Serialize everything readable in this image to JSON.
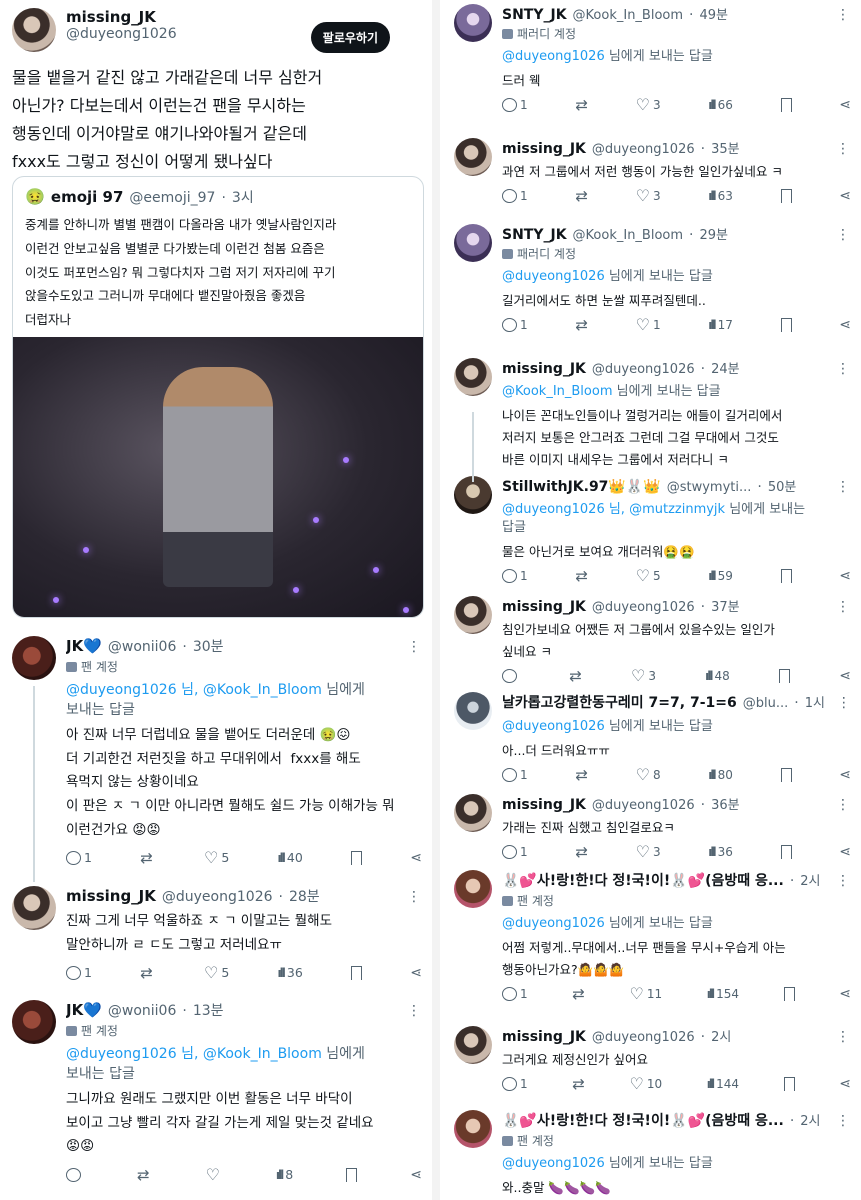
{
  "left": {
    "main_post": {
      "name": "missing_JK",
      "handle": "@duyeong1026",
      "follow_label": "팔로우하기",
      "text": "물을 뱉을거 같진 않고 가래같은데 너무 심한거\n아닌가? 다보는데서 이런는건 팬을 무시하는\n행동인데 이거야말로 얘기나와야될거 같은데\nfxxx도 그렇고 정신이 어떻게 됐나싶다"
    },
    "quote": {
      "emoji": "🤢",
      "name": "emoji 97",
      "handle": "@eemoji_97",
      "time": "3시",
      "text": "중계를 안하니까 별별 팬캠이 다올라옴 내가 옛날사람인지라\n이런건 안보고싶음 별별쿤 다가봤는데 이런건 첨봄 요즘은\n이것도 퍼포먼스임? 뭐 그렇다치자 그럼 저기 저자리에 꾸기\n앉을수도있고 그러니까 무대에다 뱉진말아줬음 좋겠음\n더럽자나"
    },
    "replies": [
      {
        "name": "JK💙",
        "handle": "@wonii06",
        "time": "30분",
        "badge": "팬 계정",
        "replyto_prefix": "",
        "replyto_links": "@duyeong1026 님, @Kook_In_Bloom",
        "replyto_suffix": " 님에게\n보내는 답글",
        "text": "아 진짜 너무 더럽네요 물을 뱉어도 더러운데 🤢😖\n더 기괴한건 저런짓을 하고 무대위에서  fxxx를 해도\n욕먹지 않는 상황이네요\n이 판은 ㅈ ㄱ 이만 아니라면 뭘해도 쉴드 가능 이해가능 뭐\n이런건가요 😡😡",
        "reply_count": "1",
        "retweet_count": "",
        "like_count": "5",
        "view_count": "40"
      },
      {
        "name": "missing_JK",
        "handle": "@duyeong1026",
        "time": "28분",
        "text": "진짜 그게 너무 억울하죠 ㅈ ㄱ 이말고는 뭘해도\n말안하니까 ㄹ ㄷ도 그렇고 저러네요ㅠ",
        "reply_count": "1",
        "retweet_count": "",
        "like_count": "5",
        "view_count": "36"
      },
      {
        "name": "JK💙",
        "handle": "@wonii06",
        "time": "13분",
        "badge": "팬 계정",
        "replyto_links": "@duyeong1026 님, @Kook_In_Bloom",
        "replyto_suffix": " 님에게\n보내는 답글",
        "text": "그니까요 원래도 그랬지만 이번 활동은 너무 바닥이\n보이고 그냥 빨리 각자 갈길 가는게 제일 맞는것 같네요\n😡😡",
        "reply_count": "",
        "retweet_count": "",
        "like_count": "",
        "view_count": "8"
      }
    ]
  },
  "right": {
    "replies": [
      {
        "name": "SNTY_JK",
        "handle": "@Kook_In_Bloom",
        "time": "49분",
        "badge": "패러디 계정",
        "replyto_link": "@duyeong1026",
        "replyto_suffix": " 님에게 보내는 답글",
        "text": "드러 웩",
        "reply_count": "1",
        "like_count": "3",
        "view_count": "66"
      },
      {
        "name": "missing_JK",
        "handle": "@duyeong1026",
        "time": "35분",
        "text": "과연 저 그룹에서 저런 행동이 가능한 일인가싶네요 ㅋ",
        "reply_count": "1",
        "like_count": "3",
        "view_count": "63"
      },
      {
        "name": "SNTY_JK",
        "handle": "@Kook_In_Bloom",
        "time": "29분",
        "badge": "패러디 계정",
        "replyto_link": "@duyeong1026",
        "replyto_suffix": " 님에게 보내는 답글",
        "text": "길거리에서도 하면 눈쌀 찌푸려질텐데..",
        "reply_count": "1",
        "like_count": "1",
        "view_count": "17"
      },
      {
        "name": "missing_JK",
        "handle": "@duyeong1026",
        "time": "24분",
        "replyto_link": "@Kook_In_Bloom",
        "replyto_suffix": " 님에게 보내는 답글",
        "text": "나이든 꼰대노인들이나 껄렁거리는 애들이 길거리에서\n저러지 보통은 안그러죠 그런데 그걸 무대에서 그것도\n바른 이미지 내세우는 그룹에서 저러다니 ㅋ",
        "reply_count": "",
        "like_count": "",
        "view_count": ""
      },
      {
        "name": "StillwithJK.97👑🐰👑",
        "handle": "@stwymyti...",
        "time": "50분",
        "replyto_link": "@duyeong1026 님, @mutzzinmyjk",
        "replyto_suffix": " 님에게 보내는\n답글",
        "text": "물은 아닌거로 보여요 개더러워🤮🤮",
        "reply_count": "1",
        "like_count": "5",
        "view_count": "59"
      },
      {
        "name": "missing_JK",
        "handle": "@duyeong1026",
        "time": "37분",
        "text": "침인가보네요 어쨌든 저 그룹에서 있을수있는 일인가\n싶네요 ㅋ",
        "reply_count": "",
        "like_count": "3",
        "view_count": "48"
      },
      {
        "name": "날카롭고강렬한동구레미 7=7, 7-1=6",
        "handle": "@blu...",
        "time": "1시",
        "replyto_link": "@duyeong1026",
        "replyto_suffix": " 님에게 보내는 답글",
        "text": "아...더 드러워요ㅠㅠ",
        "reply_count": "1",
        "like_count": "8",
        "view_count": "80"
      },
      {
        "name": "missing_JK",
        "handle": "@duyeong1026",
        "time": "36분",
        "text": "가래는 진짜 심했고 침인걸로요ㅋ",
        "reply_count": "1",
        "like_count": "3",
        "view_count": "36"
      },
      {
        "name": "🐰💕사!랑!한!다 정!국!이!🐰💕(음방때 응...",
        "handle": "",
        "time": "2시",
        "badge": "팬 계정",
        "replyto_link": "@duyeong1026",
        "replyto_suffix": " 님에게 보내는 답글",
        "text": "어쩜 저렇게..무대에서..너무 팬들을 무시+우습게 아는\n행동아닌가요?🤷🤷🤷",
        "reply_count": "1",
        "like_count": "11",
        "view_count": "154"
      },
      {
        "name": "missing_JK",
        "handle": "@duyeong1026",
        "time": "2시",
        "text": "그러게요 제정신인가 싶어요",
        "reply_count": "1",
        "like_count": "10",
        "view_count": "144"
      },
      {
        "name": "🐰💕사!랑!한!다 정!국!이!🐰💕(음방때 응...",
        "handle": "",
        "time": "2시",
        "badge": "팬 계정",
        "replyto_link": "@duyeong1026",
        "replyto_suffix": " 님에게 보내는 답글",
        "text": "와..충말 🍆🍆🍆🍆",
        "reply_count": "",
        "like_count": "",
        "view_count": ""
      }
    ]
  }
}
